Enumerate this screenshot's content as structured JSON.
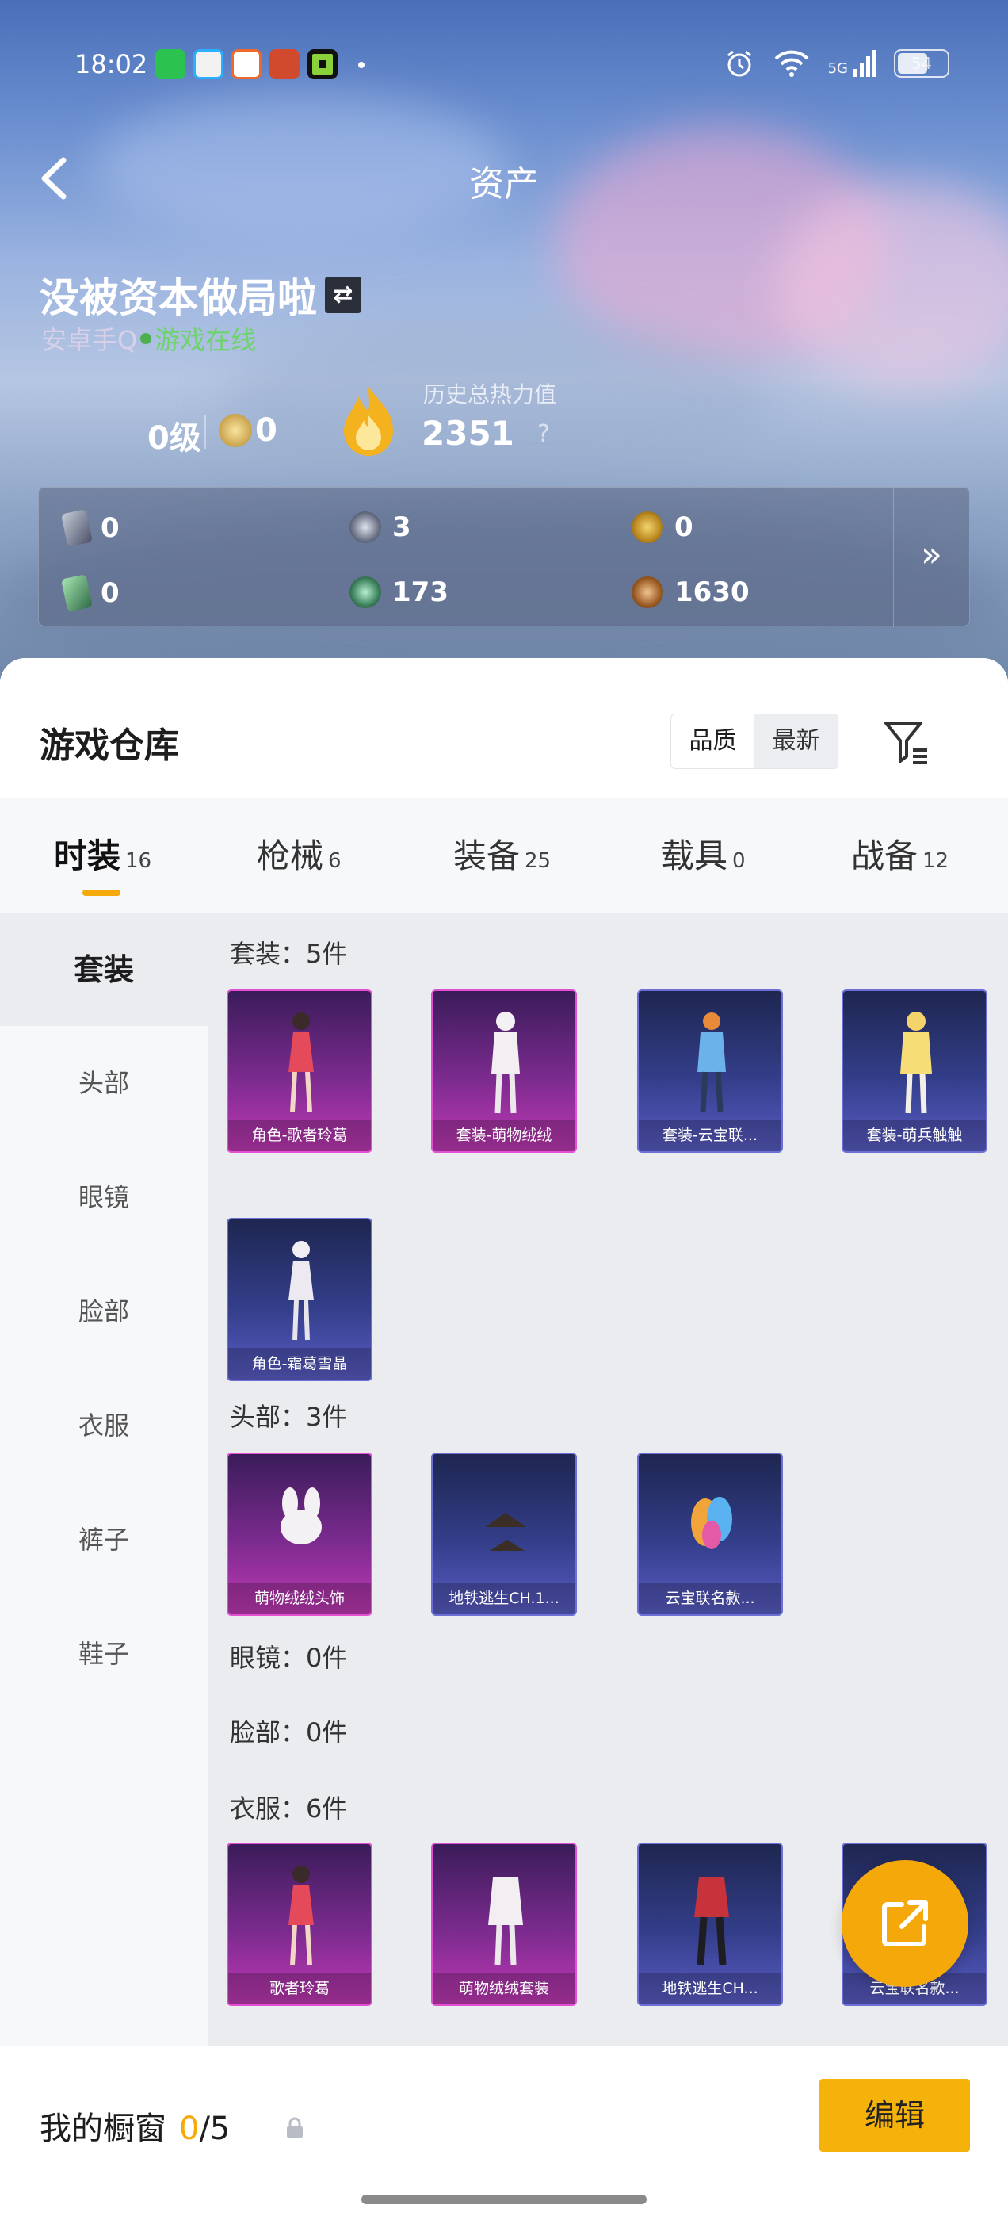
{
  "status_bar": {
    "time": "18:02",
    "network": "5G",
    "battery": "54"
  },
  "header": {
    "title": "资产"
  },
  "player": {
    "name": "没被资本做局啦",
    "platform": "安卓手Q",
    "status": "游戏在线",
    "level": "0级",
    "medals": "0",
    "heat_label": "历史总热力值",
    "heat_value": "2351",
    "help": "?"
  },
  "resources": [
    {
      "icon": "gray-card-icon",
      "value": "0"
    },
    {
      "icon": "silver-coin-icon",
      "value": "3"
    },
    {
      "icon": "gold-coin-icon",
      "value": "0"
    },
    {
      "icon": "green-card-icon",
      "value": "0"
    },
    {
      "icon": "green-orb-icon",
      "value": "173"
    },
    {
      "icon": "bronze-coin-icon",
      "value": "1630"
    }
  ],
  "warehouse": {
    "title": "游戏仓库",
    "sort": {
      "quality": "品质",
      "newest": "最新"
    }
  },
  "tabs": [
    {
      "label": "时装",
      "count": "16",
      "active": true
    },
    {
      "label": "枪械",
      "count": "6"
    },
    {
      "label": "装备",
      "count": "25"
    },
    {
      "label": "载具",
      "count": "0"
    },
    {
      "label": "战备",
      "count": "12"
    }
  ],
  "side_nav": [
    "套装",
    "头部",
    "眼镜",
    "脸部",
    "衣服",
    "裤子",
    "鞋子"
  ],
  "sections": [
    {
      "title": "套装：5件",
      "items": [
        {
          "name": "角色-歌者玲葛",
          "tier": "pink"
        },
        {
          "name": "套装-萌物绒绒",
          "tier": "pink"
        },
        {
          "name": "套装-云宝联...",
          "tier": "blue"
        },
        {
          "name": "套装-萌兵触触",
          "tier": "blue"
        },
        {
          "name": "角色-霜葛雪晶",
          "tier": "blue"
        }
      ]
    },
    {
      "title": "头部：3件",
      "items": [
        {
          "name": "萌物绒绒头饰",
          "tier": "pink"
        },
        {
          "name": "地铁逃生CH.1...",
          "tier": "blue"
        },
        {
          "name": "云宝联名款...",
          "tier": "blue"
        }
      ]
    },
    {
      "title": "眼镜：0件",
      "items": []
    },
    {
      "title": "脸部：0件",
      "items": []
    },
    {
      "title": "衣服：6件",
      "items": [
        {
          "name": "歌者玲葛",
          "tier": "pink"
        },
        {
          "name": "萌物绒绒套装",
          "tier": "pink"
        },
        {
          "name": "地铁逃生CH...",
          "tier": "blue"
        },
        {
          "name": "云宝联名款...",
          "tier": "blue"
        }
      ]
    }
  ],
  "showcase": {
    "label": "我的橱窗",
    "current": "0",
    "total": "/5",
    "edit": "编辑"
  }
}
